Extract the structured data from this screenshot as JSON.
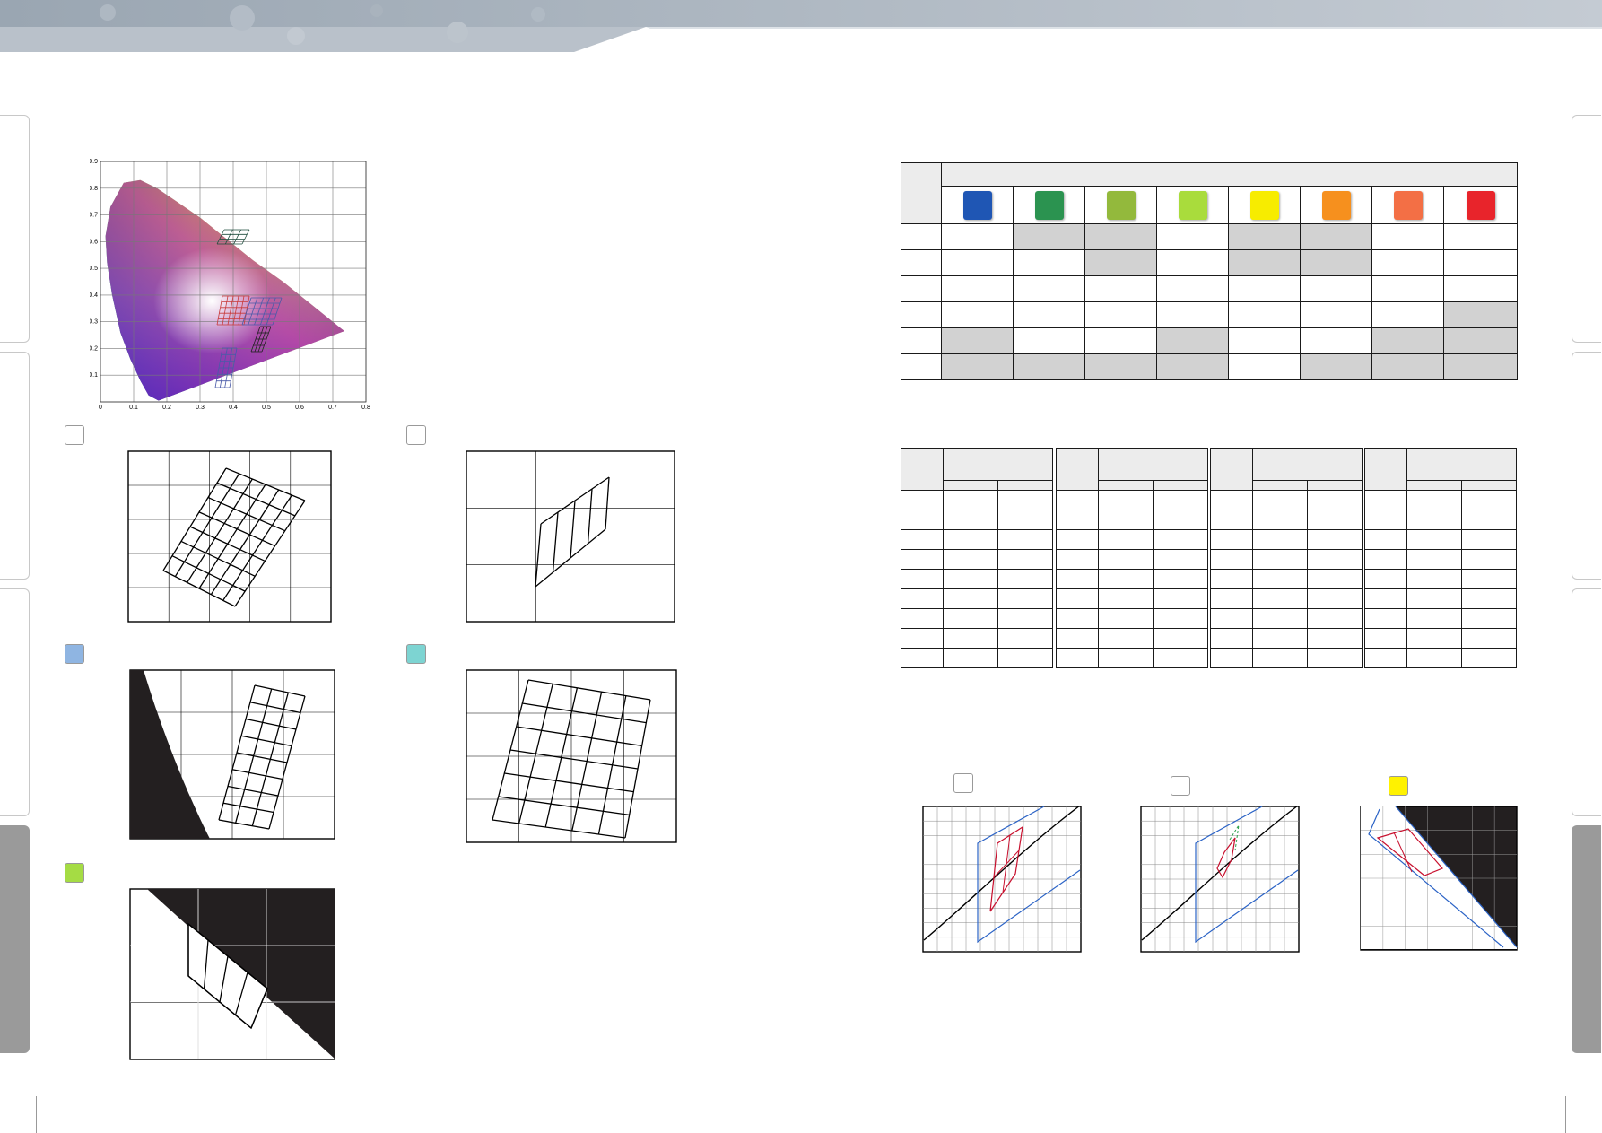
{
  "cie_chart": {
    "x_ticks": [
      "0",
      "0.1",
      "0.2",
      "0.3",
      "0.4",
      "0.5",
      "0.6",
      "0.7",
      "0.8"
    ],
    "y_ticks": [
      "0.1",
      "0.2",
      "0.3",
      "0.4",
      "0.5",
      "0.6",
      "0.7",
      "0.8",
      "0.9"
    ]
  },
  "swatches": [
    "#1f56b4",
    "#2b9350",
    "#93b93c",
    "#a9dc3c",
    "#f7ec00",
    "#f6901e",
    "#f36f45",
    "#e8242b"
  ],
  "legend_squares": [
    "#ffffff",
    "#ffffff",
    "#8fb5e2",
    "#7dd4d2",
    "#a5dc44",
    "#ffffff",
    "#ffffff",
    "#fff200"
  ]
}
